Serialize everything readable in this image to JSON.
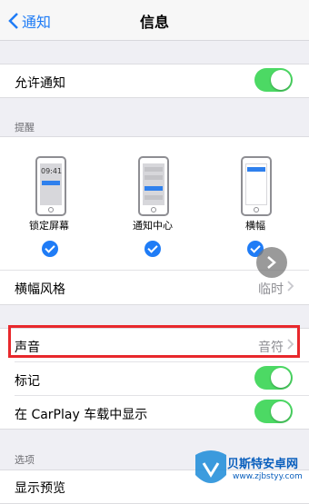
{
  "nav": {
    "back_label": "通知",
    "title": "信息"
  },
  "allow": {
    "label": "允许通知",
    "on": true
  },
  "section_alert": {
    "header": "提醒"
  },
  "styles": [
    {
      "label": "锁定屏幕",
      "time": "09:41",
      "checked": true
    },
    {
      "label": "通知中心",
      "checked": true
    },
    {
      "label": "横幅",
      "checked": true
    }
  ],
  "banner_style": {
    "label": "横幅风格",
    "value": "临时"
  },
  "sound": {
    "label": "声音",
    "value": "音符"
  },
  "badge": {
    "label": "标记",
    "on": true
  },
  "carplay": {
    "label": "在 CarPlay 车载中显示",
    "on": true
  },
  "section_options": {
    "header": "选项"
  },
  "preview": {
    "label": "显示预览"
  },
  "watermark": {
    "name": "贝斯特安卓网",
    "url": "www.zjbstyy.com"
  },
  "colors": {
    "accent": "#1f7cf6",
    "toggle_on": "#4cd964",
    "highlight": "#e8282c"
  }
}
